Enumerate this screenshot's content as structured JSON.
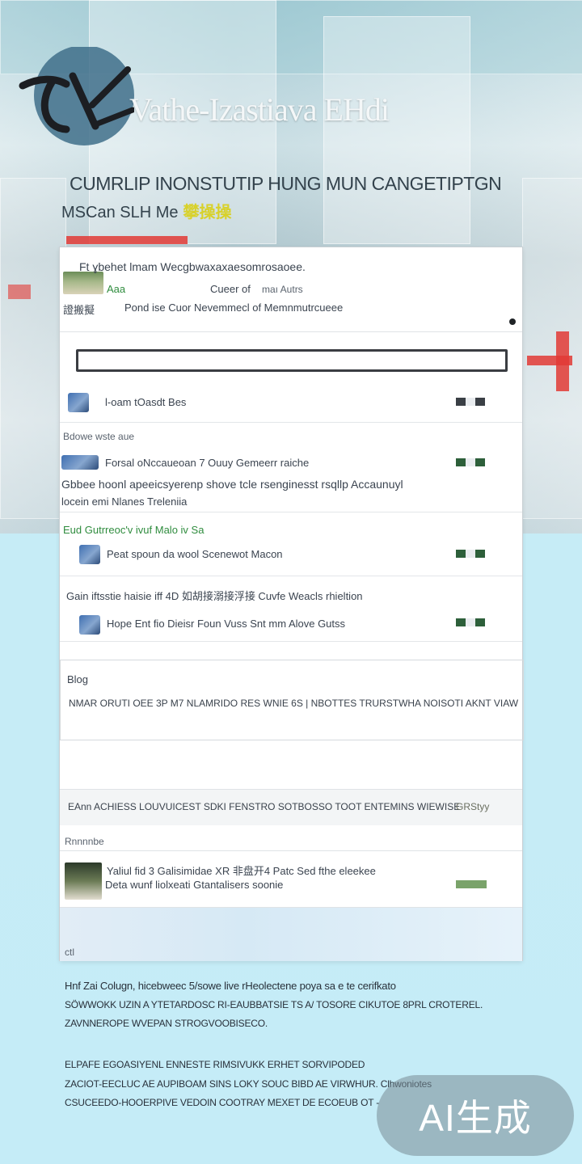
{
  "hero": {
    "title": "Vathe-Izastiava EHdi",
    "subtitle": "CUMRLIP INONSTUTIP HUNG MUN CANGETIPTGN",
    "subtitle2": "MSCan SLH Me",
    "subtitle2_cjk": "攀操操"
  },
  "header_card": {
    "line1": "Ft ɣbehet lmam Wecgbwaxaxaesomrosaoee.",
    "line2_label": "Aaa",
    "line2_mid": "Cueer of",
    "line2_right": "maı Autrs",
    "line3_left": "證搬擬",
    "line3": "Pond ise Cuor Nevemmecl of Memnmutrcueee"
  },
  "search": {
    "placeholder": ""
  },
  "rows": [
    {
      "title": "l-oam tOasdt Bes"
    },
    {
      "category": "Bdowe wste aue",
      "title": "Forsal oNccaueoan 7 Ouuy Gemeerr raiche",
      "desc": "Gbbee hoonl apeeicsyerenp shove tcle rsenginesst rsqllp Accaunuyl",
      "desc2": "locein emi Nlanes Treleniia"
    },
    {
      "category": "Eud Gutrreoc'v ivuf Malo iv Sa",
      "title": "Peat spoun da wool Scenewot Macon"
    },
    {
      "category": "Gain iftsstie haisie iff 4D 如胡接溺接浮接 Cuvfe Weacls rhieltion",
      "title": "Hope Ent fio Dieisr Foun Vuss Snt mm  Alove Gutss"
    }
  ],
  "blog": {
    "label": "Blog",
    "text": "NMAR ORUTI OEE 3P M7 NLAMRIDO RES WNIE 6S | NBOTTES TRURSTWHA NOISOTI AKNT VIAW"
  },
  "info_band": {
    "text": "EAnn ACHIESS LOUVUICEST SDKI FENSTRO  SOTBOSSO TOOT ENTEMINS WIEWISE",
    "right": "GRStyy"
  },
  "section_label": "Rnnnnbe",
  "feature": {
    "line1": "Yaliul fid 3 Galisimidae XR 非盘开4 Patc Sed fthe eleekee",
    "line2": "Deta wunf liolxeati Gtantalisers soonie"
  },
  "bottom_link": "ctl",
  "footer": {
    "p1": [
      "Hnf Zai Colugn, hicebweec 5/sowe live rHeolectene poya sa e te cerifkato",
      "SÖWWOKK UZIN  A YTETARDOSC RI-EAUBBATSIE TS A/ TOSORE CIKUTOE 8PRL CROTEREL.",
      "ZAVNNEROPE WVEPAN STROGVOOBISECO."
    ],
    "p2": [
      "ELPAFE EGOASIYENL ENNESTE RIMSIVUKK ERHET SORVIPODED",
      "ZACIOT-EECLUC AE AUPIBOAM SINS LOKY SOUC BIBD AE VIRWHUR. Clhwoniotes",
      "CSUCEEDO-HOOERPIVE VEDOIN COOTRAY MEXET DE ECOEUB OT -"
    ]
  },
  "watermark": "AI生成",
  "colors": {
    "accent_green": "#2f8c3e",
    "hero_red": "#e23a35",
    "sky_bg": "#c5ecf7"
  }
}
